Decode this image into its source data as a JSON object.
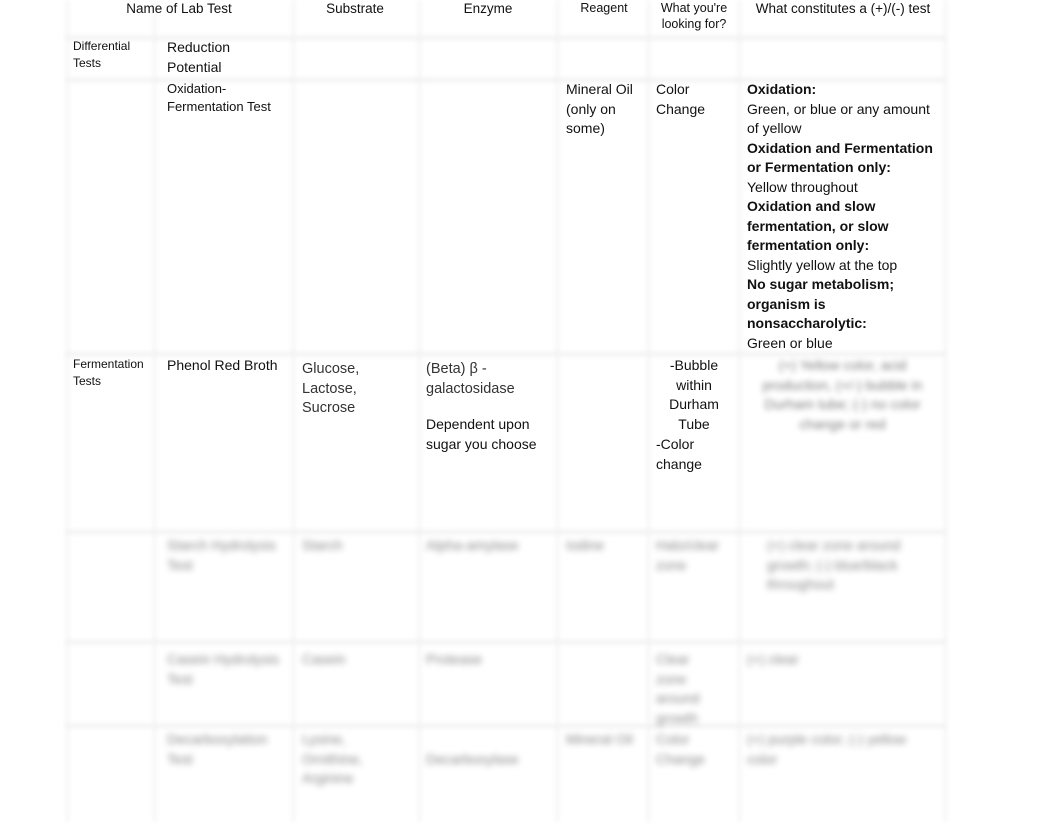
{
  "table": {
    "headers": {
      "name": "Name of Lab Test",
      "substrate": "Substrate",
      "enzyme": "Enzyme",
      "reagent": "Reagent",
      "looking_for": "What you're looking for?",
      "result": "What constitutes a (+)/(-) test"
    },
    "sections": [
      {
        "category": "Differential Tests",
        "rows": [
          {
            "name": "Reduction Potential",
            "substrate": "",
            "enzyme": "",
            "reagent": "",
            "looking_for": "",
            "result": []
          },
          {
            "name": "Oxidation-Fermentation Test",
            "substrate": "",
            "enzyme": "",
            "reagent": "Mineral Oil (only on some)",
            "looking_for": "Color Change",
            "result": [
              {
                "label": "Oxidation:",
                "text": "Green, or blue or any amount of yellow"
              },
              {
                "label": "Oxidation and Fermentation or Fermentation only:",
                "text": "Yellow throughout"
              },
              {
                "label": "Oxidation and slow fermentation, or slow fermentation only:",
                "text": "Slightly yellow at the top"
              },
              {
                "label": "No sugar metabolism; organism is nonsaccharolytic:",
                "text": "Green or blue"
              }
            ]
          }
        ]
      },
      {
        "category": "Fermentation Tests",
        "rows": [
          {
            "name": "Phenol Red Broth",
            "substrate": "Glucose, Lactose, Sucrose",
            "enzyme_line1": "(Beta) β - galactosidase",
            "enzyme_line2": "Dependent upon sugar you choose",
            "reagent": "",
            "looking_for_1": "-Bubble within Durham Tube",
            "looking_for_2": "-Color change",
            "result": "(+) Yellow color, acid production, (+/-) bubble in Durham tube; (-) no color change or red"
          }
        ]
      }
    ],
    "obscured_rows": [
      {
        "name": "Starch Hydrolysis Test",
        "substrate": "Starch",
        "enzyme": "Alpha-amylase",
        "reagent": "Iodine",
        "looking_for": "Halo/clear zone",
        "result": "(+) clear zone around growth; (-) blue/black throughout"
      },
      {
        "name": "Casein Hydrolysis Test",
        "substrate": "Casein",
        "enzyme": "Protease",
        "reagent": "",
        "looking_for": "Clear zone around growth",
        "result": "(+) clear"
      },
      {
        "name": "Decarboxylation Test",
        "substrate": "Lysine, Ornithine, Arginine",
        "enzyme": "Decarboxylase",
        "reagent": "Mineral Oil",
        "looking_for": "Color Change",
        "result": "(+) purple color; (-) yellow color"
      }
    ]
  }
}
